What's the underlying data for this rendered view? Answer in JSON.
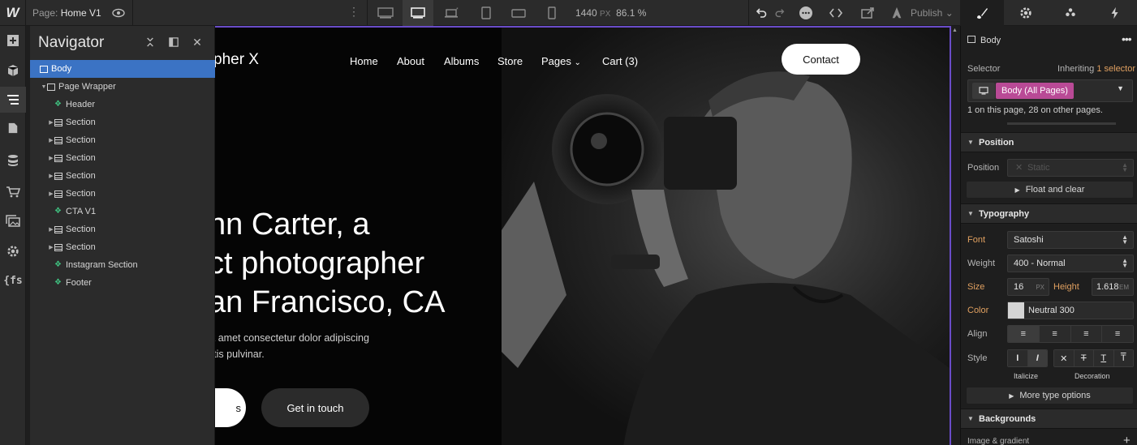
{
  "topbar": {
    "logo": "W",
    "page_prefix": "Page:",
    "page_name": "Home V1",
    "width_value": "1440",
    "width_unit": "PX",
    "zoom": "86.1 %",
    "publish_label": "Publish"
  },
  "navigator": {
    "title": "Navigator",
    "tree": [
      {
        "label": "Body",
        "icon": "box",
        "level": 0,
        "selected": true
      },
      {
        "label": "Page Wrapper",
        "icon": "box",
        "level": 1,
        "expanded": true
      },
      {
        "label": "Header",
        "icon": "component",
        "level": 2
      },
      {
        "label": "Section",
        "icon": "section",
        "level": 2
      },
      {
        "label": "Section",
        "icon": "section",
        "level": 2
      },
      {
        "label": "Section",
        "icon": "section",
        "level": 2
      },
      {
        "label": "Section",
        "icon": "section",
        "level": 2
      },
      {
        "label": "Section",
        "icon": "section",
        "level": 2
      },
      {
        "label": "CTA V1",
        "icon": "component",
        "level": 2
      },
      {
        "label": "Section",
        "icon": "section",
        "level": 2
      },
      {
        "label": "Section",
        "icon": "section",
        "level": 2
      },
      {
        "label": "Instagram Section",
        "icon": "component",
        "level": 2
      },
      {
        "label": "Footer",
        "icon": "component",
        "level": 2
      }
    ]
  },
  "canvas": {
    "brand": "pher X",
    "nav_links": [
      "Home",
      "About",
      "Albums",
      "Store",
      "Pages",
      "Cart (3)"
    ],
    "contact_label": "Contact",
    "hero_lines": [
      "nn Carter, a",
      "ct photographer",
      "an Francisco, CA"
    ],
    "hero_sub": [
      "it amet consectetur dolor adipiscing",
      "rtis pulvinar."
    ],
    "btn_primary": "s",
    "btn_secondary": "Get in touch"
  },
  "panel": {
    "element_name": "Body",
    "selector_label": "Selector",
    "inheriting_prefix": "Inheriting",
    "inheriting_link": "1 selector",
    "selector_tag": "Body (All Pages)",
    "selector_note": "1 on this page, 28 on other pages.",
    "position_header": "Position",
    "position_label": "Position",
    "position_value": "Static",
    "float_clear": "Float and clear",
    "typography_header": "Typography",
    "font_label": "Font",
    "font_value": "Satoshi",
    "weight_label": "Weight",
    "weight_value": "400 - Normal",
    "size_label": "Size",
    "size_value": "16",
    "size_unit": "PX",
    "height_label": "Height",
    "height_value": "1.618",
    "height_unit": "EM",
    "color_label": "Color",
    "color_value": "Neutral 300",
    "align_label": "Align",
    "style_label": "Style",
    "italicize_label": "Italicize",
    "decoration_label": "Decoration",
    "more_type": "More type options",
    "backgrounds_header": "Backgrounds",
    "image_gradient": "Image & gradient"
  },
  "colors": {
    "accent_blue": "#3b73c4",
    "selector_pink": "#b94a96",
    "canvas_outline": "#6a4cc9",
    "orange_label": "#e0a060",
    "component_green": "#3fbf7f"
  }
}
